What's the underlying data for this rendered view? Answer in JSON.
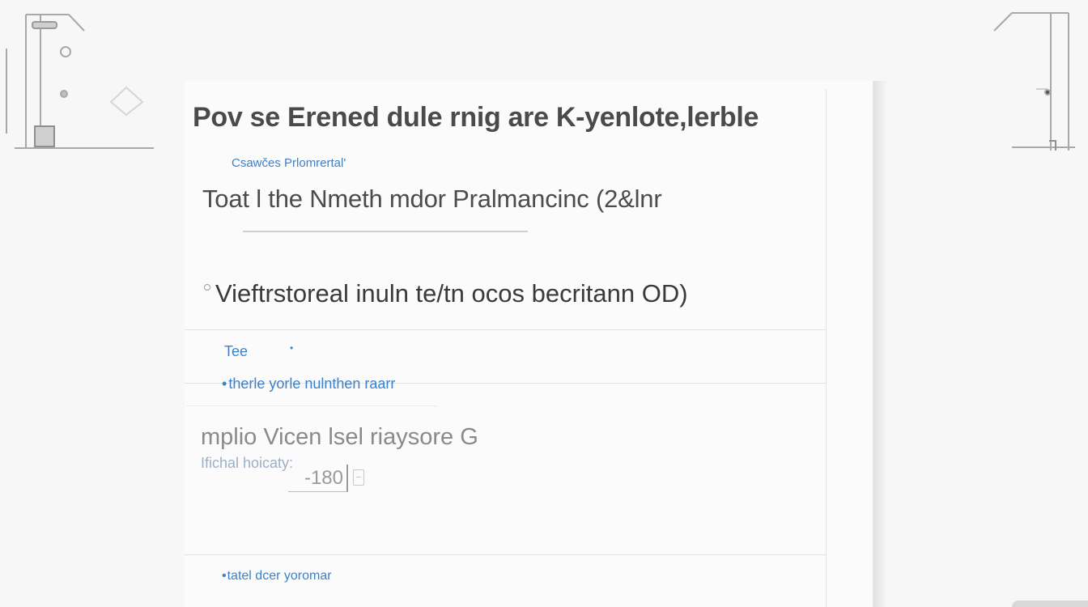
{
  "form": {
    "title": "Pov se Erened dule rnig are K-yenlote,lerble",
    "section_label": "Csawčes Prlomrertal'",
    "field_title": "Toat l the Nmeth mdor Pralmancinc (2&lnr",
    "radio_option": "Vieftrstoreal inuln te/tn ocos becritann OD)",
    "tag_label": "Tee",
    "tag_marker": "•",
    "link_text": "therle yorle nulnthen raarr",
    "sub_heading": "mplio Vicen lsel riaysore G",
    "small_label": "Ifichal hoicaty:",
    "quantity_value": "-180",
    "footer_link": "tatel dcer yoromar"
  },
  "colors": {
    "accent": "#3d7fc9",
    "text": "#3a3a3a",
    "background": "#f7f7f7"
  },
  "icons": {
    "left_decoration": "tool-rack-icon",
    "right_decoration": "frame-bracket-icon",
    "stepper": "stepper-icon"
  }
}
